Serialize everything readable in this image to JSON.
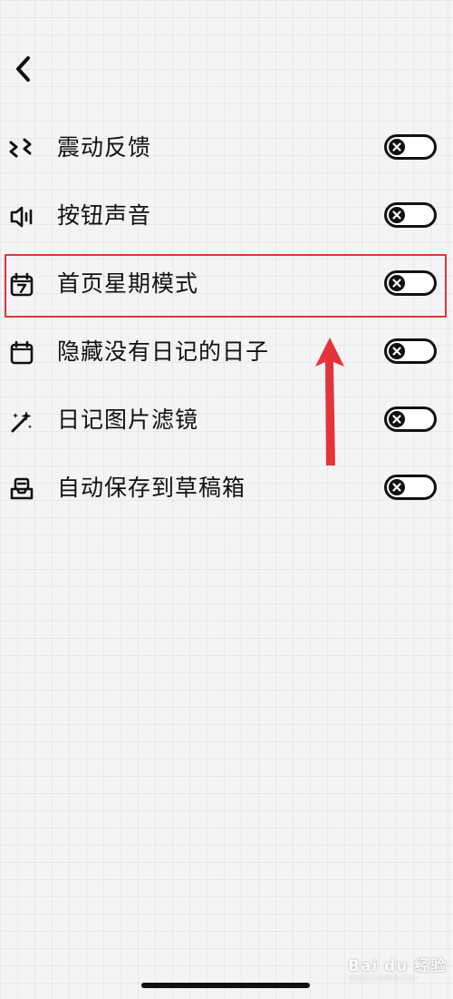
{
  "settings": {
    "items": [
      {
        "label": "震动反馈",
        "icon": "vibration-icon",
        "enabled": false
      },
      {
        "label": "按钮声音",
        "icon": "speaker-icon",
        "enabled": false
      },
      {
        "label": "首页星期模式",
        "icon": "calendar-week-icon",
        "enabled": false
      },
      {
        "label": "隐藏没有日记的日子",
        "icon": "calendar-icon",
        "enabled": false
      },
      {
        "label": "日记图片滤镜",
        "icon": "magic-wand-icon",
        "enabled": false
      },
      {
        "label": "自动保存到草稿箱",
        "icon": "inbox-tray-icon",
        "enabled": false
      }
    ]
  },
  "annotation": {
    "highlighted_item": "首页星期模式",
    "color": "#e3343c"
  },
  "watermark": {
    "text": "Bai du 经验",
    "sub": "jingyan.baidu.com"
  },
  "colors": {
    "ink": "#111111",
    "background": "#f4f4f4",
    "annotation_red": "#e3343c"
  }
}
